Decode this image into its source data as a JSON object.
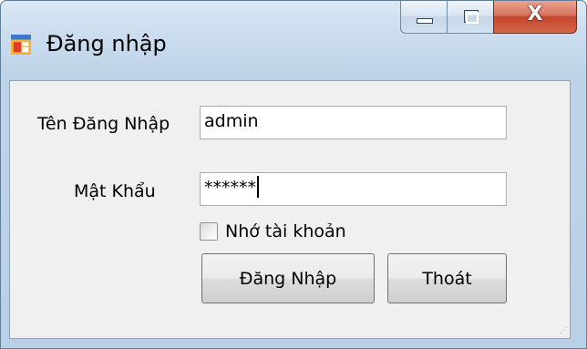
{
  "window": {
    "title": "Đăng nhập",
    "caption_buttons": {
      "minimize_icon": "minimize-icon",
      "maximize_icon": "maximize-icon",
      "close_glyph": "X"
    }
  },
  "form": {
    "username_label": "Tên Đăng Nhập",
    "username_value": "admin",
    "password_label": "Mật Khẩu",
    "password_value": "******",
    "remember_label": "Nhớ tài khoản",
    "remember_checked": false,
    "login_button": "Đăng Nhập",
    "exit_button": "Thoát"
  },
  "colors": {
    "title_bar": "#cadcee",
    "close_button": "#c4452d",
    "client_background": "#f0f0f0"
  }
}
